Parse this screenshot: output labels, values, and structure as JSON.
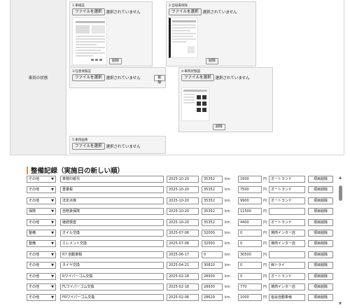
{
  "vehicle_docs": {
    "row_label": "車両の状態",
    "file_button": "ファイルを選択",
    "no_file_text": "選択されていません",
    "delete_label": "削除",
    "slots": [
      {
        "title": "1:車検証"
      },
      {
        "title": "2:自賠責保険"
      },
      {
        "title": "3:任意保険証"
      },
      {
        "title": "4:車両状態図"
      },
      {
        "title": "5:車両画像"
      }
    ]
  },
  "maintenance": {
    "title": "整備記録（実施日の新しい順）",
    "km_unit": "km",
    "yen_unit": "円",
    "delete_label": "項目削除",
    "rows": [
      {
        "category": "その他",
        "item": "車検印紙代",
        "date": "2025-10-20",
        "km": "35352",
        "price": "1600",
        "shop": "オートランド"
      },
      {
        "category": "その他",
        "item": "重量税",
        "date": "2025-10-20",
        "km": "35352",
        "price": "7500",
        "shop": "オートランド"
      },
      {
        "category": "その他",
        "item": "法定点検",
        "date": "2025-10-20",
        "km": "35352",
        "price": "9900",
        "shop": "オートランド"
      },
      {
        "category": "保険",
        "item": "自賠責保険",
        "date": "2025-10-20",
        "km": "35352",
        "price": "11500",
        "shop": ""
      },
      {
        "category": "その他",
        "item": "継続検査",
        "date": "2025-10-20",
        "km": "35352",
        "price": "4400",
        "shop": "オートランド"
      },
      {
        "category": "整備",
        "item": "オイル交換",
        "date": "2025-07-06",
        "km": "32000",
        "price": "0",
        "shop": "焼肉インター店"
      },
      {
        "category": "整備",
        "item": "エレメント交換",
        "date": "2025-07-06",
        "km": "32000",
        "price": "0",
        "shop": "焼肉インター店"
      },
      {
        "category": "その他",
        "item": "R7 自動車税",
        "date": "2025-06-17",
        "km": "0",
        "price": "30500",
        "shop": ""
      },
      {
        "category": "その他",
        "item": "タイヤ交換",
        "date": "2025-04-21",
        "km": "30810",
        "price": "0",
        "shop": "㈱トライ"
      },
      {
        "category": "その他",
        "item": "Rワイパーゴム交換",
        "date": "2025-02-18",
        "km": "28930",
        "price": "0",
        "shop": "オートランド"
      },
      {
        "category": "その他",
        "item": "FLワイパーゴム交換",
        "date": "2025-02-18",
        "km": "28930",
        "price": "770",
        "shop": "焼肉インター店"
      },
      {
        "category": "その他",
        "item": "FRワイパーゴム交換",
        "date": "2025-02-06",
        "km": "28629",
        "price": "1000",
        "shop": "塩谷自動車様"
      }
    ]
  },
  "scrollbar": {
    "up_icon": "triangle-up-icon",
    "down_icon": "triangle-down-icon"
  }
}
